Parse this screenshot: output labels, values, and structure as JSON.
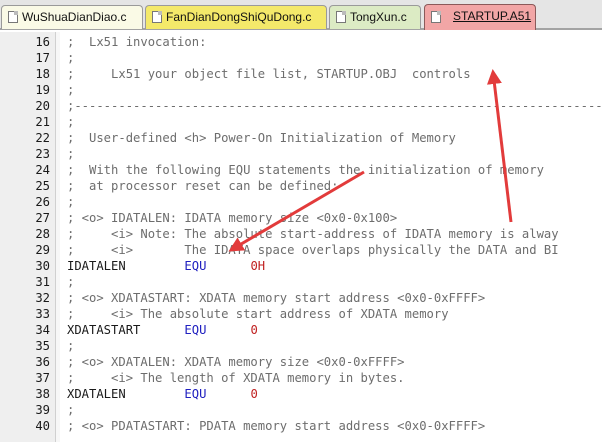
{
  "tabs": [
    {
      "label": "WuShuaDianDiao.c",
      "active": false
    },
    {
      "label": "FanDianDongShiQuDong.c",
      "active": false
    },
    {
      "label": "TongXun.c",
      "active": false
    },
    {
      "label": "STARTUP.A51",
      "active": true
    }
  ],
  "editor": {
    "lines": [
      {
        "n": "16",
        "type": "comment",
        "text": ";  Lx51 invocation:"
      },
      {
        "n": "17",
        "type": "comment",
        "text": ";"
      },
      {
        "n": "18",
        "type": "comment",
        "text": ";     Lx51 your object file list, STARTUP.OBJ  controls"
      },
      {
        "n": "19",
        "type": "comment",
        "text": ";"
      },
      {
        "n": "20",
        "type": "comment",
        "text": ";------------------------------------------------------------------------------"
      },
      {
        "n": "21",
        "type": "comment",
        "text": ";"
      },
      {
        "n": "22",
        "type": "comment",
        "text": ";  User-defined <h> Power-On Initialization of Memory"
      },
      {
        "n": "23",
        "type": "comment",
        "text": ";"
      },
      {
        "n": "24",
        "type": "comment",
        "text": ";  With the following EQU statements the initialization of memory"
      },
      {
        "n": "25",
        "type": "comment",
        "text": ";  at processor reset can be defined:"
      },
      {
        "n": "26",
        "type": "comment",
        "text": ";"
      },
      {
        "n": "27",
        "type": "comment",
        "text": "; <o> IDATALEN: IDATA memory size <0x0-0x100>"
      },
      {
        "n": "28",
        "type": "comment",
        "text": ";     <i> Note: The absolute start-address of IDATA memory is alway"
      },
      {
        "n": "29",
        "type": "comment",
        "text": ";     <i>       The IDATA space overlaps physically the DATA and BI"
      },
      {
        "n": "30",
        "type": "directive",
        "name": "IDATALEN",
        "kw": "EQU",
        "val": "0H"
      },
      {
        "n": "31",
        "type": "comment",
        "text": ";"
      },
      {
        "n": "32",
        "type": "comment",
        "text": "; <o> XDATASTART: XDATA memory start address <0x0-0xFFFF>"
      },
      {
        "n": "33",
        "type": "comment",
        "text": ";     <i> The absolute start address of XDATA memory"
      },
      {
        "n": "34",
        "type": "directive",
        "name": "XDATASTART",
        "kw": "EQU",
        "val": "0"
      },
      {
        "n": "35",
        "type": "comment",
        "text": ";"
      },
      {
        "n": "36",
        "type": "comment",
        "text": "; <o> XDATALEN: XDATA memory size <0x0-0xFFFF>"
      },
      {
        "n": "37",
        "type": "comment",
        "text": ";     <i> The length of XDATA memory in bytes."
      },
      {
        "n": "38",
        "type": "directive",
        "name": "XDATALEN",
        "kw": "EQU",
        "val": "0"
      },
      {
        "n": "39",
        "type": "comment",
        "text": ";"
      },
      {
        "n": "40",
        "type": "comment",
        "text": "; <o> PDATASTART: PDATA memory start address <0x0-0xFFFF>"
      }
    ]
  },
  "annotation": {
    "arrow_color": "#e23b3b"
  }
}
